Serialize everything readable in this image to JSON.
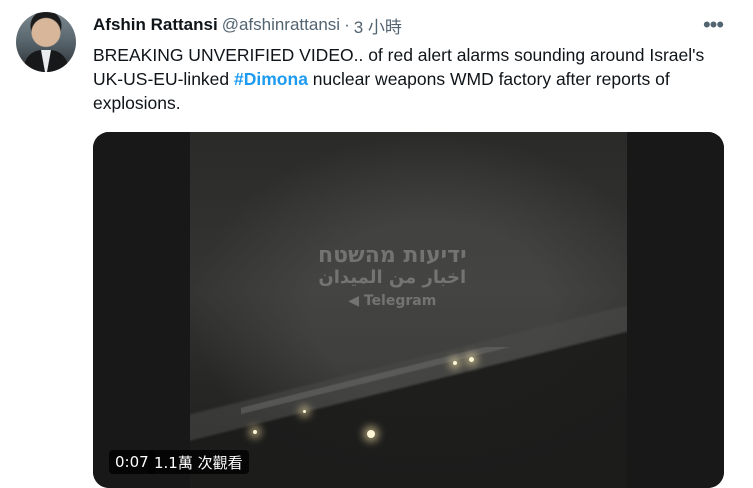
{
  "tweet": {
    "author": {
      "name": "Afshin Rattansi",
      "handle": "@afshinrattansi",
      "time_separator": "·",
      "time": "3 小時"
    },
    "more_label": "•••",
    "text_lines": [
      "BREAKING UNVERIFIED VIDEO.. of red alert alarms sounding around Israel's",
      "UK-US-EU-linked",
      "#Dimona",
      "nuclear weapons WMD factory after reports of",
      "explosions."
    ],
    "media": {
      "watermark": {
        "line1": "ידיעות מהשטח",
        "line2": "اخبار من الميدان",
        "line3": "◀ Telegram"
      },
      "duration": "0:07",
      "views": "1.1萬 次觀看"
    },
    "colors": {
      "text": "#0f1419",
      "secondary": "#536471",
      "link": "#1d9bf0"
    }
  }
}
